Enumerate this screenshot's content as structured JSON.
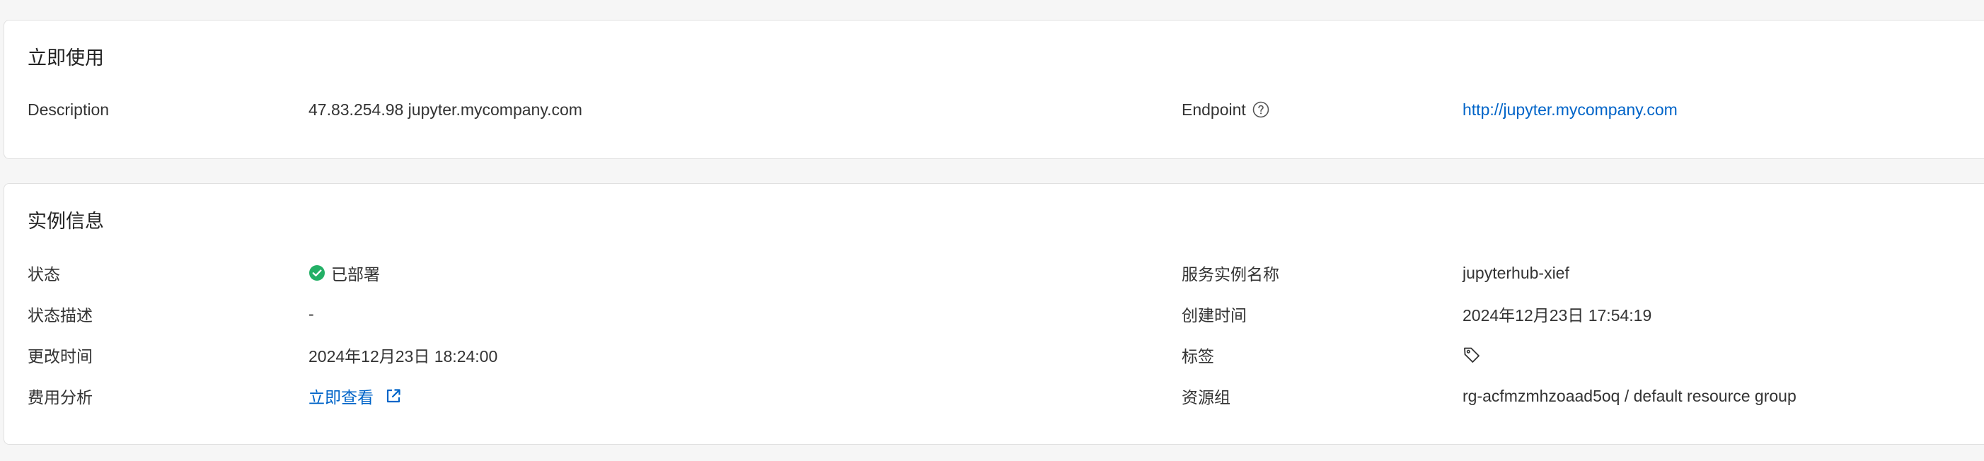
{
  "usage": {
    "title": "立即使用",
    "description_label": "Description",
    "description_value": "47.83.254.98 jupyter.mycompany.com",
    "endpoint_label": "Endpoint",
    "endpoint_value": "http://jupyter.mycompany.com"
  },
  "instance": {
    "title": "实例信息",
    "status_label": "状态",
    "status_value": "已部署",
    "status_desc_label": "状态描述",
    "status_desc_value": "-",
    "modified_label": "更改时间",
    "modified_value": "2024年12月23日 18:24:00",
    "cost_label": "费用分析",
    "cost_link": "立即查看",
    "name_label": "服务实例名称",
    "name_value": "jupyterhub-xief",
    "created_label": "创建时间",
    "created_value": "2024年12月23日 17:54:19",
    "tags_label": "标签",
    "resource_group_label": "资源组",
    "resource_group_value": "rg-acfmzmhzoaad5oq / default resource group"
  },
  "icons": {
    "endpoint_help": "help-circle-icon",
    "status": "check-circle-icon",
    "cost_link": "external-link-icon",
    "tags": "tag-icon"
  },
  "colors": {
    "link": "#0064c8",
    "success": "#23b066",
    "card_border": "#e0e0e0",
    "text": "#333333"
  }
}
